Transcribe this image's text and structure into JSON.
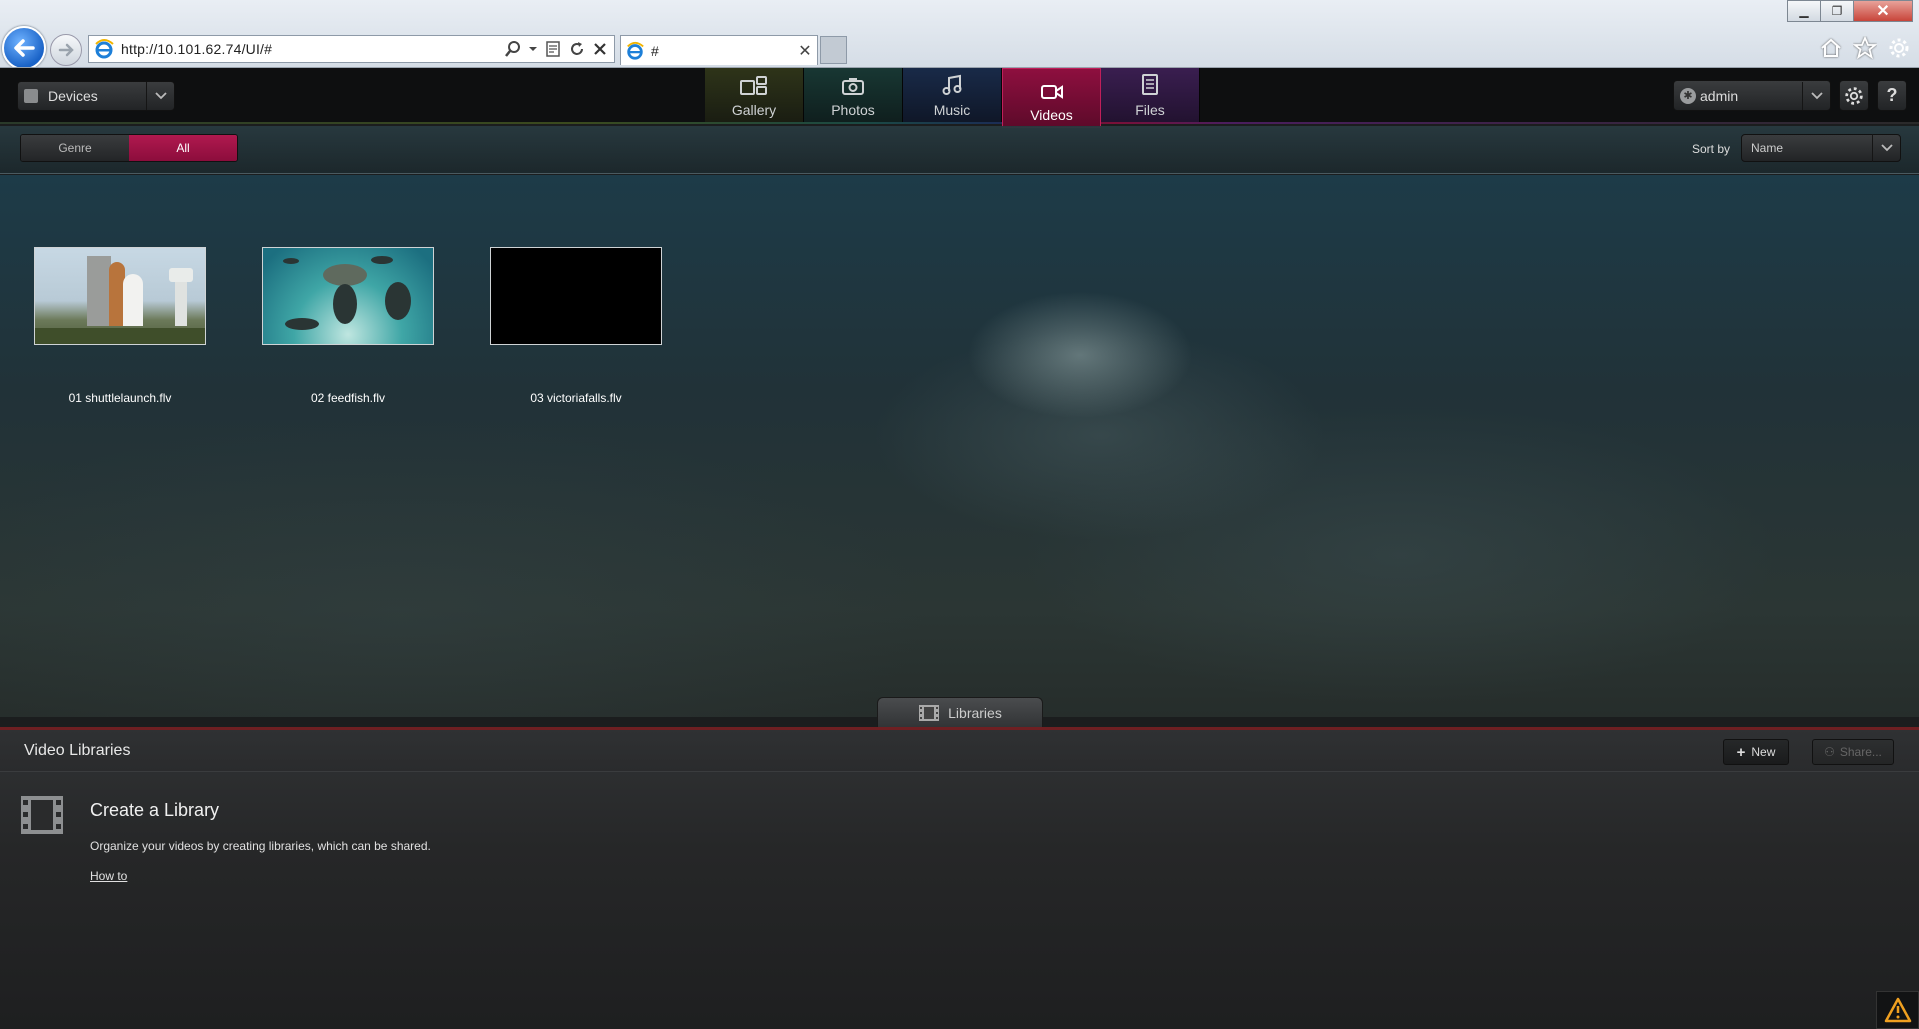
{
  "browser": {
    "address": "http://10.101.62.74/UI/#",
    "tab_title": "#"
  },
  "topbar": {
    "devices_label": "Devices",
    "user_label": "admin",
    "help_label": "?"
  },
  "nav": {
    "tabs": [
      {
        "label": "Gallery"
      },
      {
        "label": "Photos"
      },
      {
        "label": "Music"
      },
      {
        "label": "Videos"
      },
      {
        "label": "Files"
      }
    ],
    "active": "Videos"
  },
  "filter": {
    "genre_label": "Genre",
    "all_label": "All",
    "sort_label": "Sort by",
    "sort_value": "Name"
  },
  "videos": [
    {
      "name": "01 shuttlelaunch.flv"
    },
    {
      "name": "02 feedfish.flv"
    },
    {
      "name": "03 victoriafalls.flv"
    }
  ],
  "libraries": {
    "tab_label": "Libraries",
    "panel_title": "Video Libraries",
    "new_label": "New",
    "share_label": "Share...",
    "create_title": "Create a Library",
    "create_desc": "Organize your videos by creating libraries, which can be shared.",
    "howto_label": "How to"
  },
  "colors": {
    "accent": "#a3124a",
    "panel_border": "#6e1f22"
  }
}
